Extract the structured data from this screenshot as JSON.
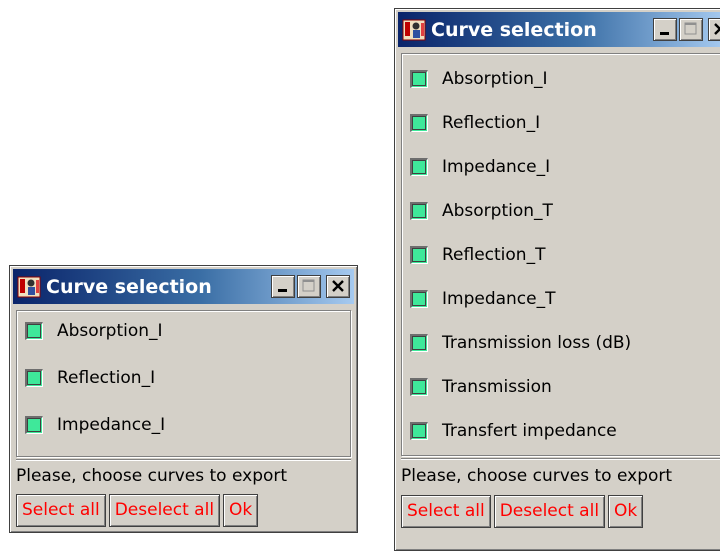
{
  "windows": [
    {
      "title": "Curve selection",
      "items": [
        {
          "label": "Absorption_I"
        },
        {
          "label": "Reflection_I"
        },
        {
          "label": "Impedance_I"
        }
      ],
      "status": "Please, choose curves to export",
      "buttons": {
        "select_all": "Select all",
        "deselect_all": "Deselect all",
        "ok": "Ok"
      }
    },
    {
      "title": "Curve selection",
      "items": [
        {
          "label": "Absorption_I"
        },
        {
          "label": "Reflection_I"
        },
        {
          "label": "Impedance_I"
        },
        {
          "label": "Absorption_T"
        },
        {
          "label": "Reflection_T"
        },
        {
          "label": "Impedance_T"
        },
        {
          "label": "Transmission loss (dB)"
        },
        {
          "label": "Transmission"
        },
        {
          "label": "Transfert impedance"
        }
      ],
      "status": "Please, choose curves to export",
      "buttons": {
        "select_all": "Select all",
        "deselect_all": "Deselect all",
        "ok": "Ok"
      }
    }
  ],
  "colors": {
    "titlebar_start": "#0a246a",
    "titlebar_end": "#a6caf0",
    "window_bg": "#d4d0c8",
    "checkbox_fill": "#3fe89a",
    "button_text": "#ff0000"
  },
  "icons": [
    "app-icon",
    "minimize-icon",
    "maximize-icon",
    "close-icon"
  ]
}
